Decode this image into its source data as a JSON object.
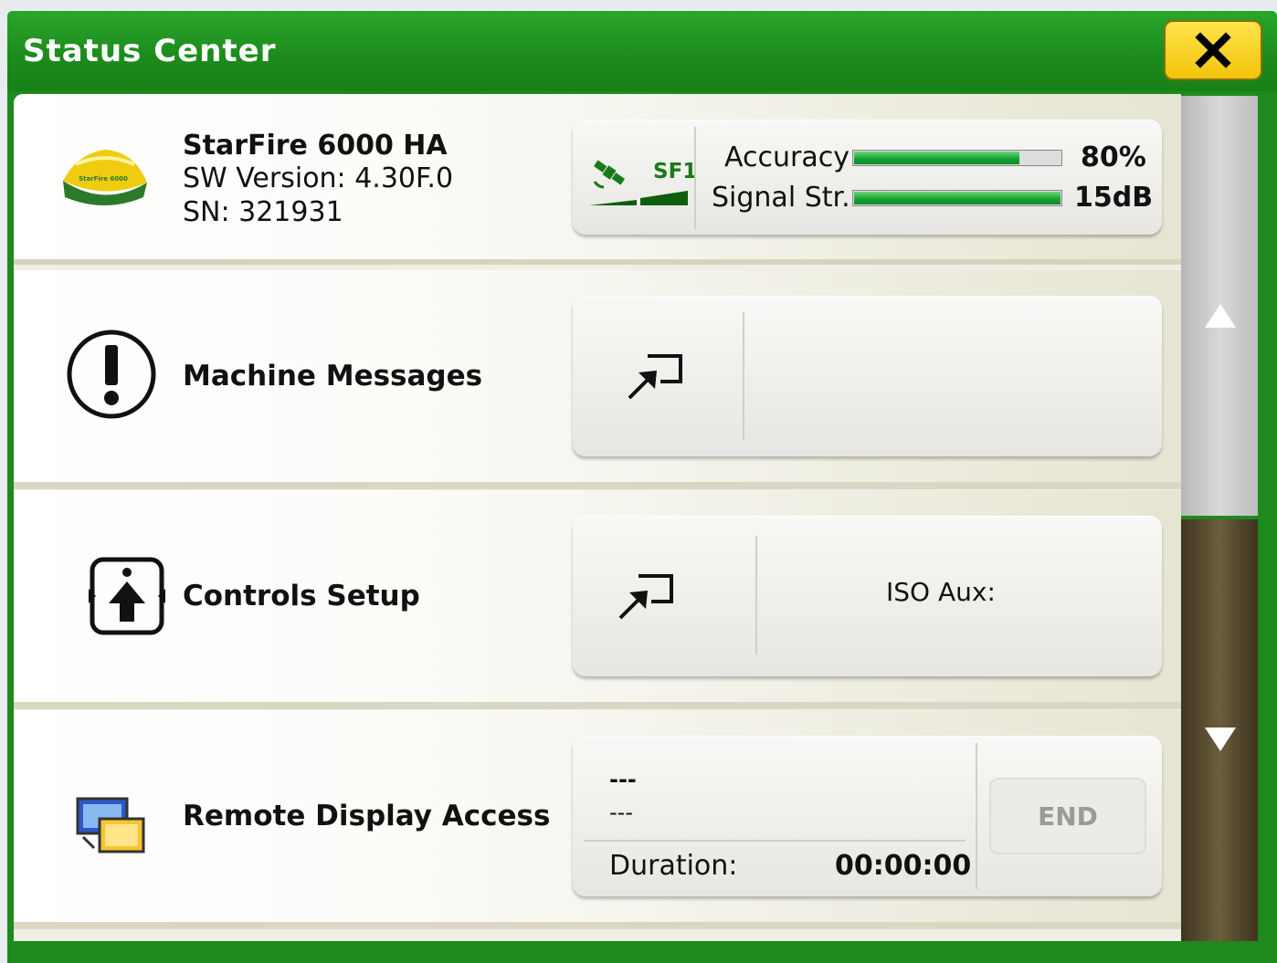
{
  "window": {
    "title": "Status Center",
    "close_icon": "close-x-icon"
  },
  "receiver": {
    "name": "StarFire 6000 HA",
    "sw_version": "SW Version: 4.30F.0",
    "serial": "SN: 321931",
    "logo_text": "StarFire 6000",
    "signal_tag": "SF1",
    "accuracy_label": "Accuracy",
    "accuracy_value": "80%",
    "accuracy_fraction": 0.8,
    "signal_label": "Signal Str.",
    "signal_value": "15dB",
    "signal_fraction": 1.0
  },
  "machine_messages": {
    "label": "Machine Messages",
    "icon": "exclamation-icon",
    "button_icon": "open-shortcut-icon"
  },
  "controls_setup": {
    "label": "Controls Setup",
    "icon": "controls-icon",
    "button_icon": "open-shortcut-icon",
    "info": "ISO Aux:"
  },
  "remote_display": {
    "label": "Remote Display Access",
    "icon": "remote-display-icon",
    "line1": "---",
    "line2": "---",
    "duration_label": "Duration:",
    "duration_value": "00:00:00",
    "end_label": "END"
  },
  "scrollbar": {
    "up_icon": "scroll-up-icon",
    "down_icon": "scroll-down-icon"
  },
  "colors": {
    "title_green": "#1e8a1e",
    "close_yellow": "#f7d117",
    "bar_green": "#15a032"
  }
}
